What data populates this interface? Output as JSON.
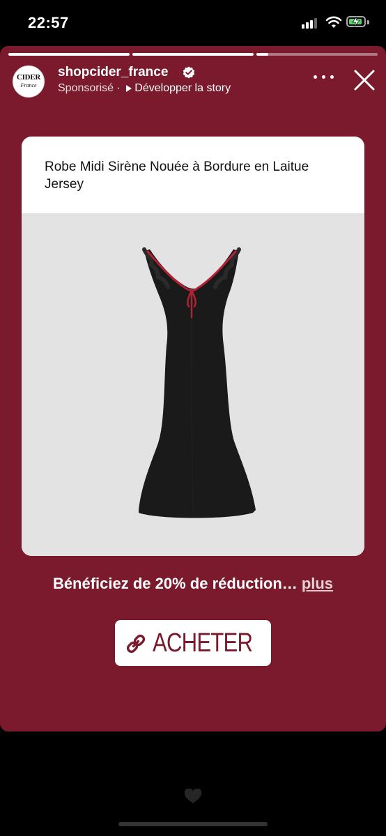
{
  "status_bar": {
    "time": "22:57",
    "signal_bars_active": 3,
    "signal_bars_total": 4,
    "battery_charging": true,
    "colors": {
      "battery": "#4cd964"
    }
  },
  "story": {
    "background_color": "#7a1a2c",
    "progress_segments": [
      1.0,
      1.0,
      0.1
    ],
    "account": {
      "avatar_text_top": "CIDER",
      "avatar_text_bottom": "France",
      "username": "shopcider_france",
      "verified": true,
      "sponsored_label": "Sponsorisé",
      "separator": "·",
      "expand_label": "Développer la story"
    },
    "icons": {
      "more": "more-horizontal-icon",
      "close": "close-icon",
      "link": "link-icon",
      "verified": "verified-badge-icon"
    }
  },
  "product": {
    "title": "Robe Midi Sirène Nouée à Bordure en Laitue Jersey",
    "image_desc_icon": "black-mermaid-dress-image"
  },
  "promo": {
    "text": "Bénéficiez de 20% de réduction…",
    "more_label": "plus"
  },
  "cta": {
    "label": "ACHETER"
  }
}
